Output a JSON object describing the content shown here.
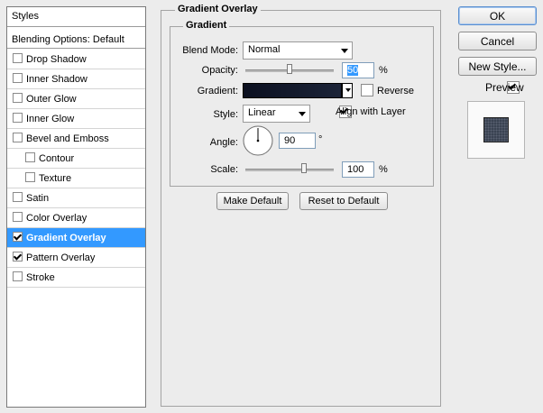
{
  "styles_list": {
    "header": "Styles",
    "blending_options": "Blending Options: Default",
    "items": [
      {
        "label": "Drop Shadow",
        "checked": false
      },
      {
        "label": "Inner Shadow",
        "checked": false
      },
      {
        "label": "Outer Glow",
        "checked": false
      },
      {
        "label": "Inner Glow",
        "checked": false
      },
      {
        "label": "Bevel and Emboss",
        "checked": false
      },
      {
        "label": "Contour",
        "checked": false
      },
      {
        "label": "Texture",
        "checked": false
      },
      {
        "label": "Satin",
        "checked": false
      },
      {
        "label": "Color Overlay",
        "checked": false
      },
      {
        "label": "Gradient Overlay",
        "checked": true,
        "selected": true
      },
      {
        "label": "Pattern Overlay",
        "checked": true
      },
      {
        "label": "Stroke",
        "checked": false
      }
    ]
  },
  "panel": {
    "title": "Gradient Overlay",
    "group_title": "Gradient",
    "blend_mode_label": "Blend Mode:",
    "blend_mode_value": "Normal",
    "opacity_label": "Opacity:",
    "opacity_value": "50",
    "opacity_unit": "%",
    "opacity_level": 50,
    "gradient_label": "Gradient:",
    "gradient_colors": [
      "#0b1020",
      "#1c2438"
    ],
    "reverse_label": "Reverse",
    "reverse_checked": false,
    "style_label": "Style:",
    "style_value": "Linear",
    "align_label": "Align with Layer",
    "align_checked": true,
    "angle_label": "Angle:",
    "angle_value": "90",
    "angle_unit": "°",
    "scale_label": "Scale:",
    "scale_value": "100",
    "scale_unit": "%",
    "scale_level": 100,
    "make_default": "Make Default",
    "reset_default": "Reset to Default"
  },
  "actions": {
    "ok": "OK",
    "cancel": "Cancel",
    "new_style": "New Style...",
    "preview_label": "Preview",
    "preview_checked": true
  },
  "colors": {
    "selection": "#3399ff",
    "preview_swatch": "#3a4352"
  }
}
